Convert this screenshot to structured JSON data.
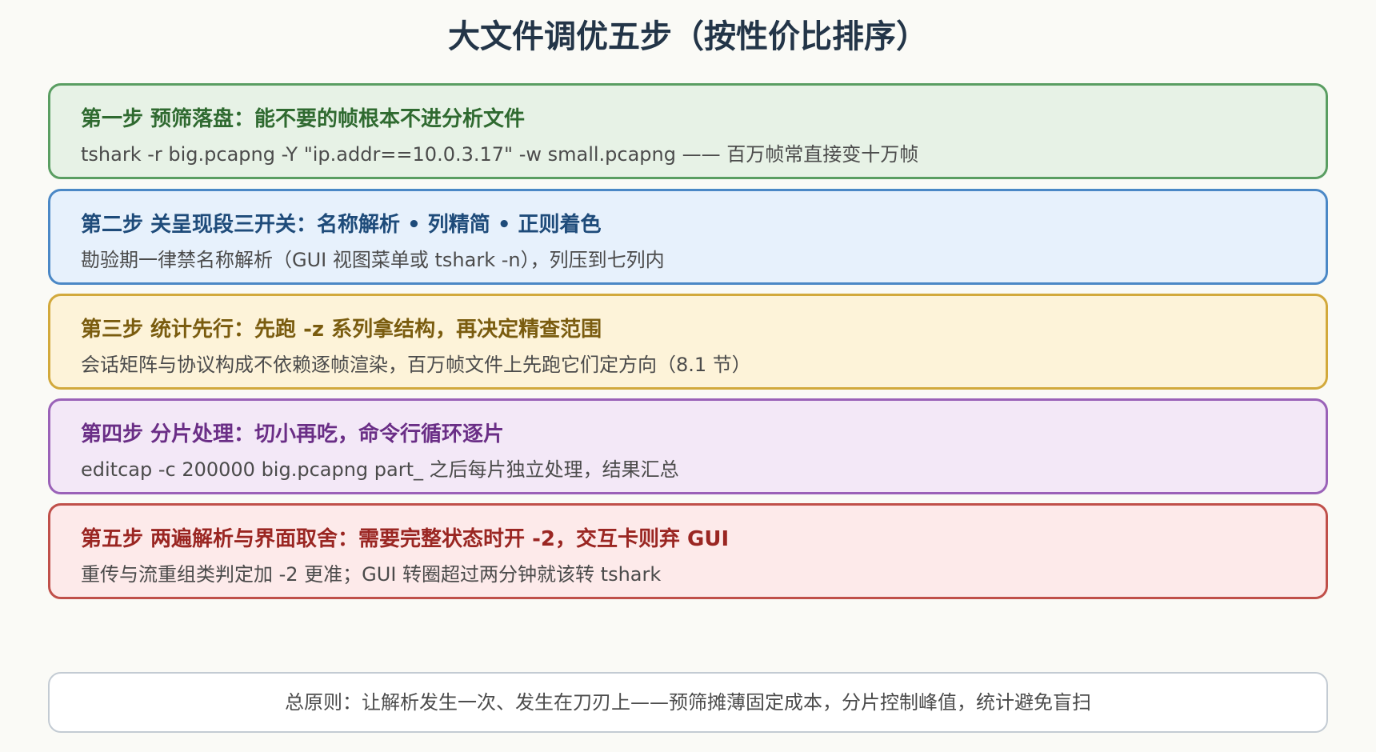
{
  "title": "大文件调优五步（按性价比排序）",
  "colors": {
    "background": "#fafaf6",
    "title_text": "#233548",
    "step1": {
      "border": "#5a9e62",
      "fill": "#e7f2e6",
      "text": "#2f6a30"
    },
    "step2": {
      "border": "#4b88c6",
      "fill": "#e7f1fc",
      "text": "#1e4b7a"
    },
    "step3": {
      "border": "#d2a93c",
      "fill": "#fdf3d9",
      "text": "#7a5c0f"
    },
    "step4": {
      "border": "#9a62b8",
      "fill": "#f3e8f7",
      "text": "#6a2e86"
    },
    "step5": {
      "border": "#c0504a",
      "fill": "#fdeaea",
      "text": "#9a2622"
    },
    "summary_border": "#c3cbd3"
  },
  "steps": [
    {
      "title": "第一步 预筛落盘：能不要的帧根本不进分析文件",
      "desc": "tshark -r big.pcapng -Y \"ip.addr==10.0.3.17\" -w small.pcapng —— 百万帧常直接变十万帧"
    },
    {
      "title": "第二步 关呈现段三开关：名称解析 • 列精简 • 正则着色",
      "desc": "勘验期一律禁名称解析（GUI 视图菜单或 tshark -n），列压到七列内"
    },
    {
      "title": "第三步 统计先行：先跑 -z 系列拿结构，再决定精查范围",
      "desc": "会话矩阵与协议构成不依赖逐帧渲染，百万帧文件上先跑它们定方向（8.1 节）"
    },
    {
      "title": "第四步 分片处理：切小再吃，命令行循环逐片",
      "desc": "editcap -c 200000 big.pcapng part_ 之后每片独立处理，结果汇总"
    },
    {
      "title": "第五步 两遍解析与界面取舍：需要完整状态时开 -2，交互卡则弃 GUI",
      "desc": "重传与流重组类判定加 -2 更准；GUI 转圈超过两分钟就该转 tshark"
    }
  ],
  "summary": "总原则：让解析发生一次、发生在刀刃上——预筛摊薄固定成本，分片控制峰值，统计避免盲扫"
}
